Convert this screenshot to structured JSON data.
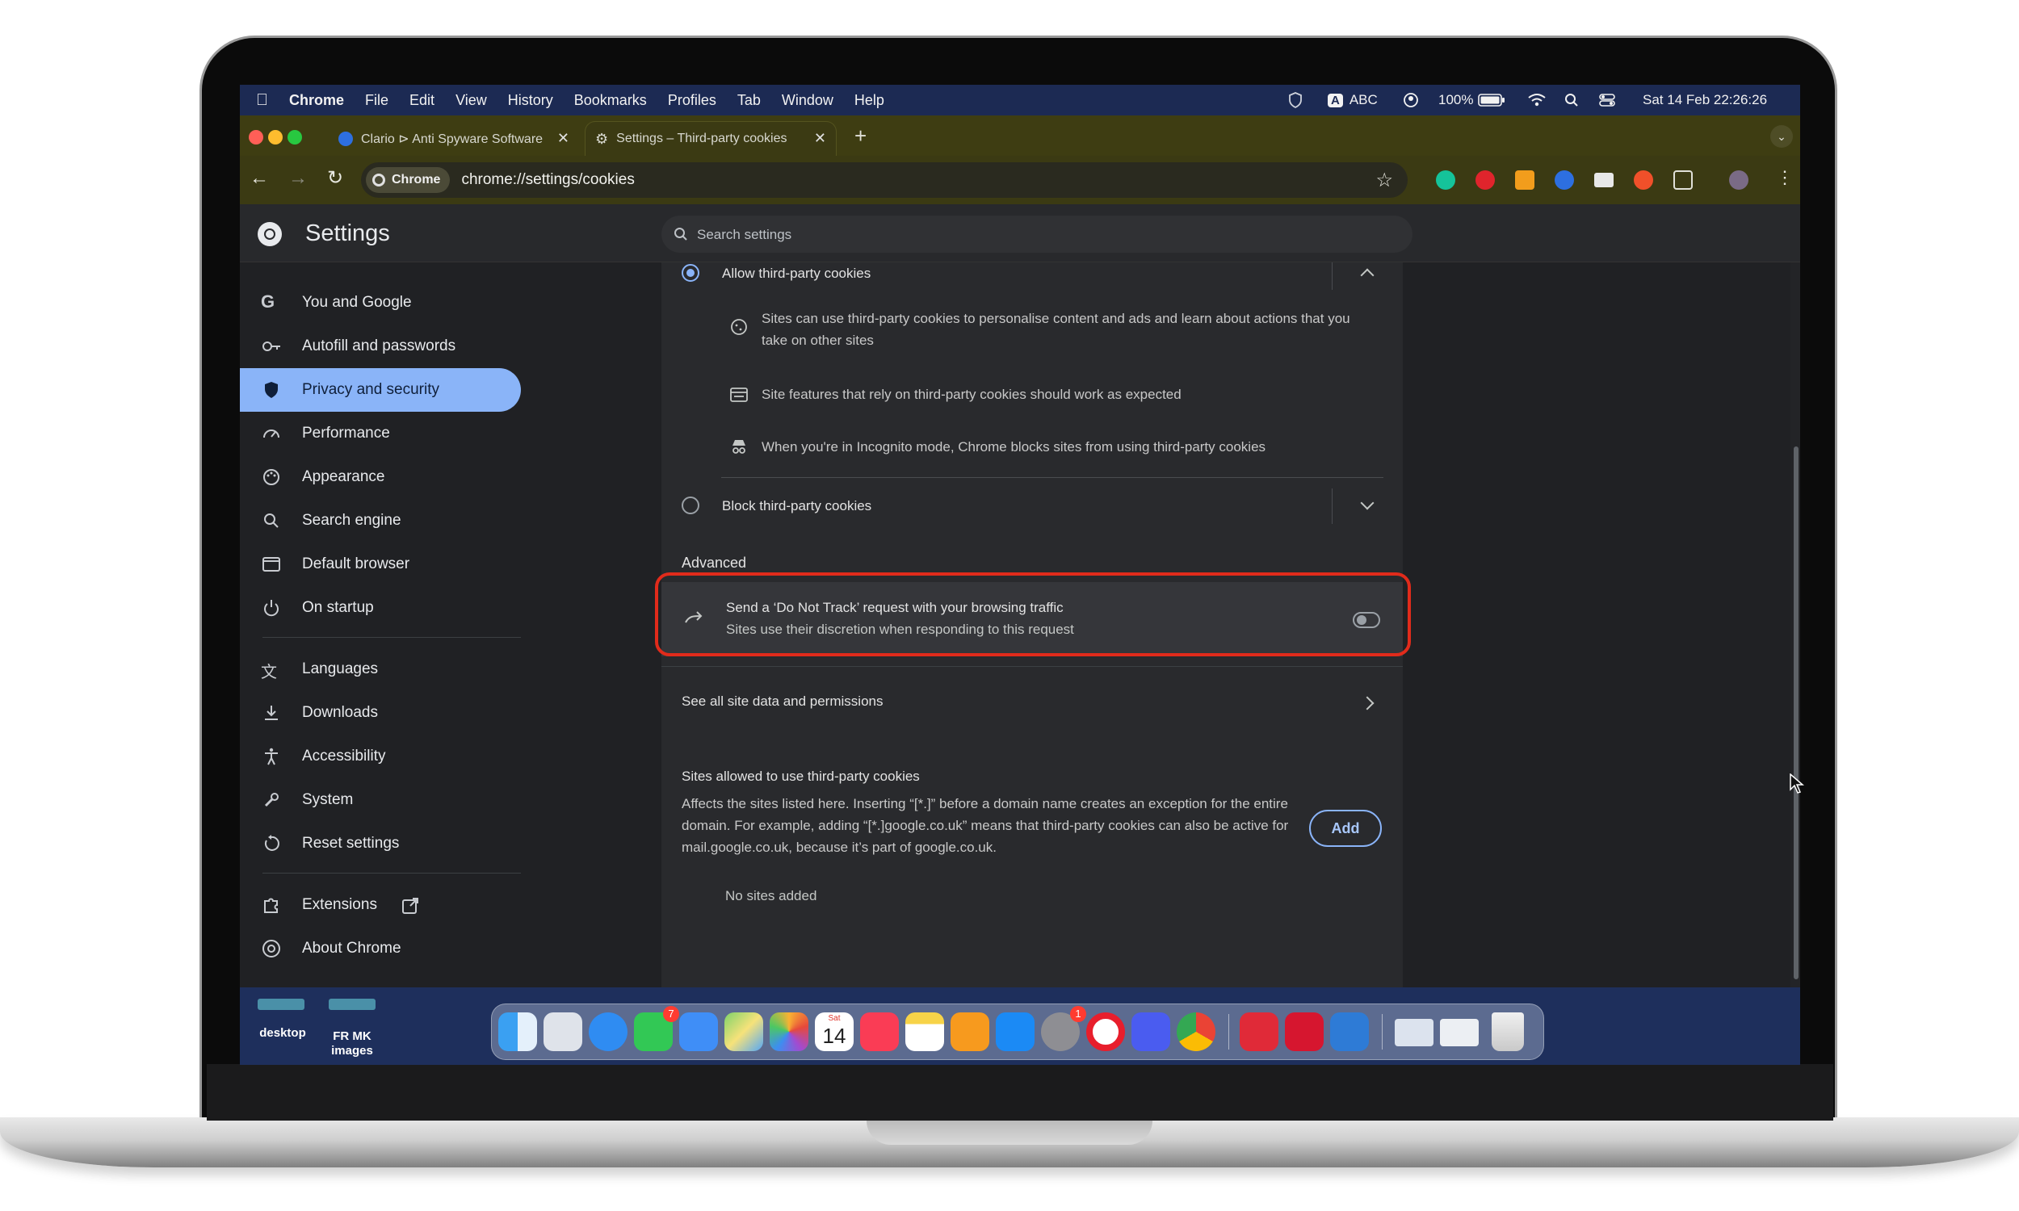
{
  "menubar": {
    "app": "Chrome",
    "items": [
      "File",
      "Edit",
      "View",
      "History",
      "Bookmarks",
      "Profiles",
      "Tab",
      "Window",
      "Help"
    ],
    "input_source": "ABC",
    "input_badge": "A",
    "battery": "100%",
    "datetime": "Sat 14 Feb  22:26:26"
  },
  "tabs": [
    {
      "title": "Clario ⊳ Anti Spyware Software",
      "active": false
    },
    {
      "title": "Settings – Third-party cookies",
      "active": true
    }
  ],
  "toolbar": {
    "chip_label": "Chrome",
    "url": "chrome://settings/cookies"
  },
  "settings": {
    "title": "Settings",
    "search_placeholder": "Search settings",
    "nav": [
      {
        "label": "You and Google",
        "icon": "google-g-icon"
      },
      {
        "label": "Autofill and passwords",
        "icon": "key-icon"
      },
      {
        "label": "Privacy and security",
        "icon": "shield-icon",
        "selected": true
      },
      {
        "label": "Performance",
        "icon": "speedometer-icon"
      },
      {
        "label": "Appearance",
        "icon": "palette-icon"
      },
      {
        "label": "Search engine",
        "icon": "search-icon"
      },
      {
        "label": "Default browser",
        "icon": "browser-window-icon"
      },
      {
        "label": "On startup",
        "icon": "power-icon"
      },
      {
        "label": "Languages",
        "icon": "translate-icon"
      },
      {
        "label": "Downloads",
        "icon": "download-icon"
      },
      {
        "label": "Accessibility",
        "icon": "accessibility-icon"
      },
      {
        "label": "System",
        "icon": "wrench-icon"
      },
      {
        "label": "Reset settings",
        "icon": "reset-icon"
      },
      {
        "label": "Extensions",
        "icon": "puzzle-icon"
      },
      {
        "label": "About Chrome",
        "icon": "chrome-icon"
      }
    ],
    "allow_option": {
      "label": "Allow third-party cookies",
      "selected": true,
      "details": [
        "Sites can use third-party cookies to personalise content and ads and learn about actions that you take on other sites",
        "Site features that rely on third-party cookies should work as expected",
        "When you're in Incognito mode, Chrome blocks sites from using third-party cookies"
      ]
    },
    "block_option": {
      "label": "Block third-party cookies",
      "selected": false
    },
    "advanced_heading": "Advanced",
    "dnt": {
      "title": "Send a ‘Do Not Track’ request with your browsing traffic",
      "subtitle": "Sites use their discretion when responding to this request",
      "enabled": false
    },
    "site_data_link": "See all site data and permissions",
    "allowed_section": {
      "heading": "Sites allowed to use third-party cookies",
      "description": "Affects the sites listed here. Inserting “[*.]” before a domain name creates an exception for the entire domain. For example, adding “[*.]google.co.uk” means that third-party cookies can also be active for mail.google.co.uk, because it’s part of google.co.uk.",
      "add_button": "Add",
      "empty_text": "No sites added"
    }
  },
  "desktop": {
    "folders": [
      "desktop",
      "FR MK images"
    ]
  },
  "dock": {
    "badges": {
      "messages": "7",
      "system_settings": "1"
    },
    "calendar": {
      "month": "Sat",
      "day": "14"
    }
  },
  "colors": {
    "accent": "#8ab4f8",
    "highlight_outline": "#e12b1b",
    "page_bg": "#202124",
    "tabstrip": "#3e3d12"
  }
}
